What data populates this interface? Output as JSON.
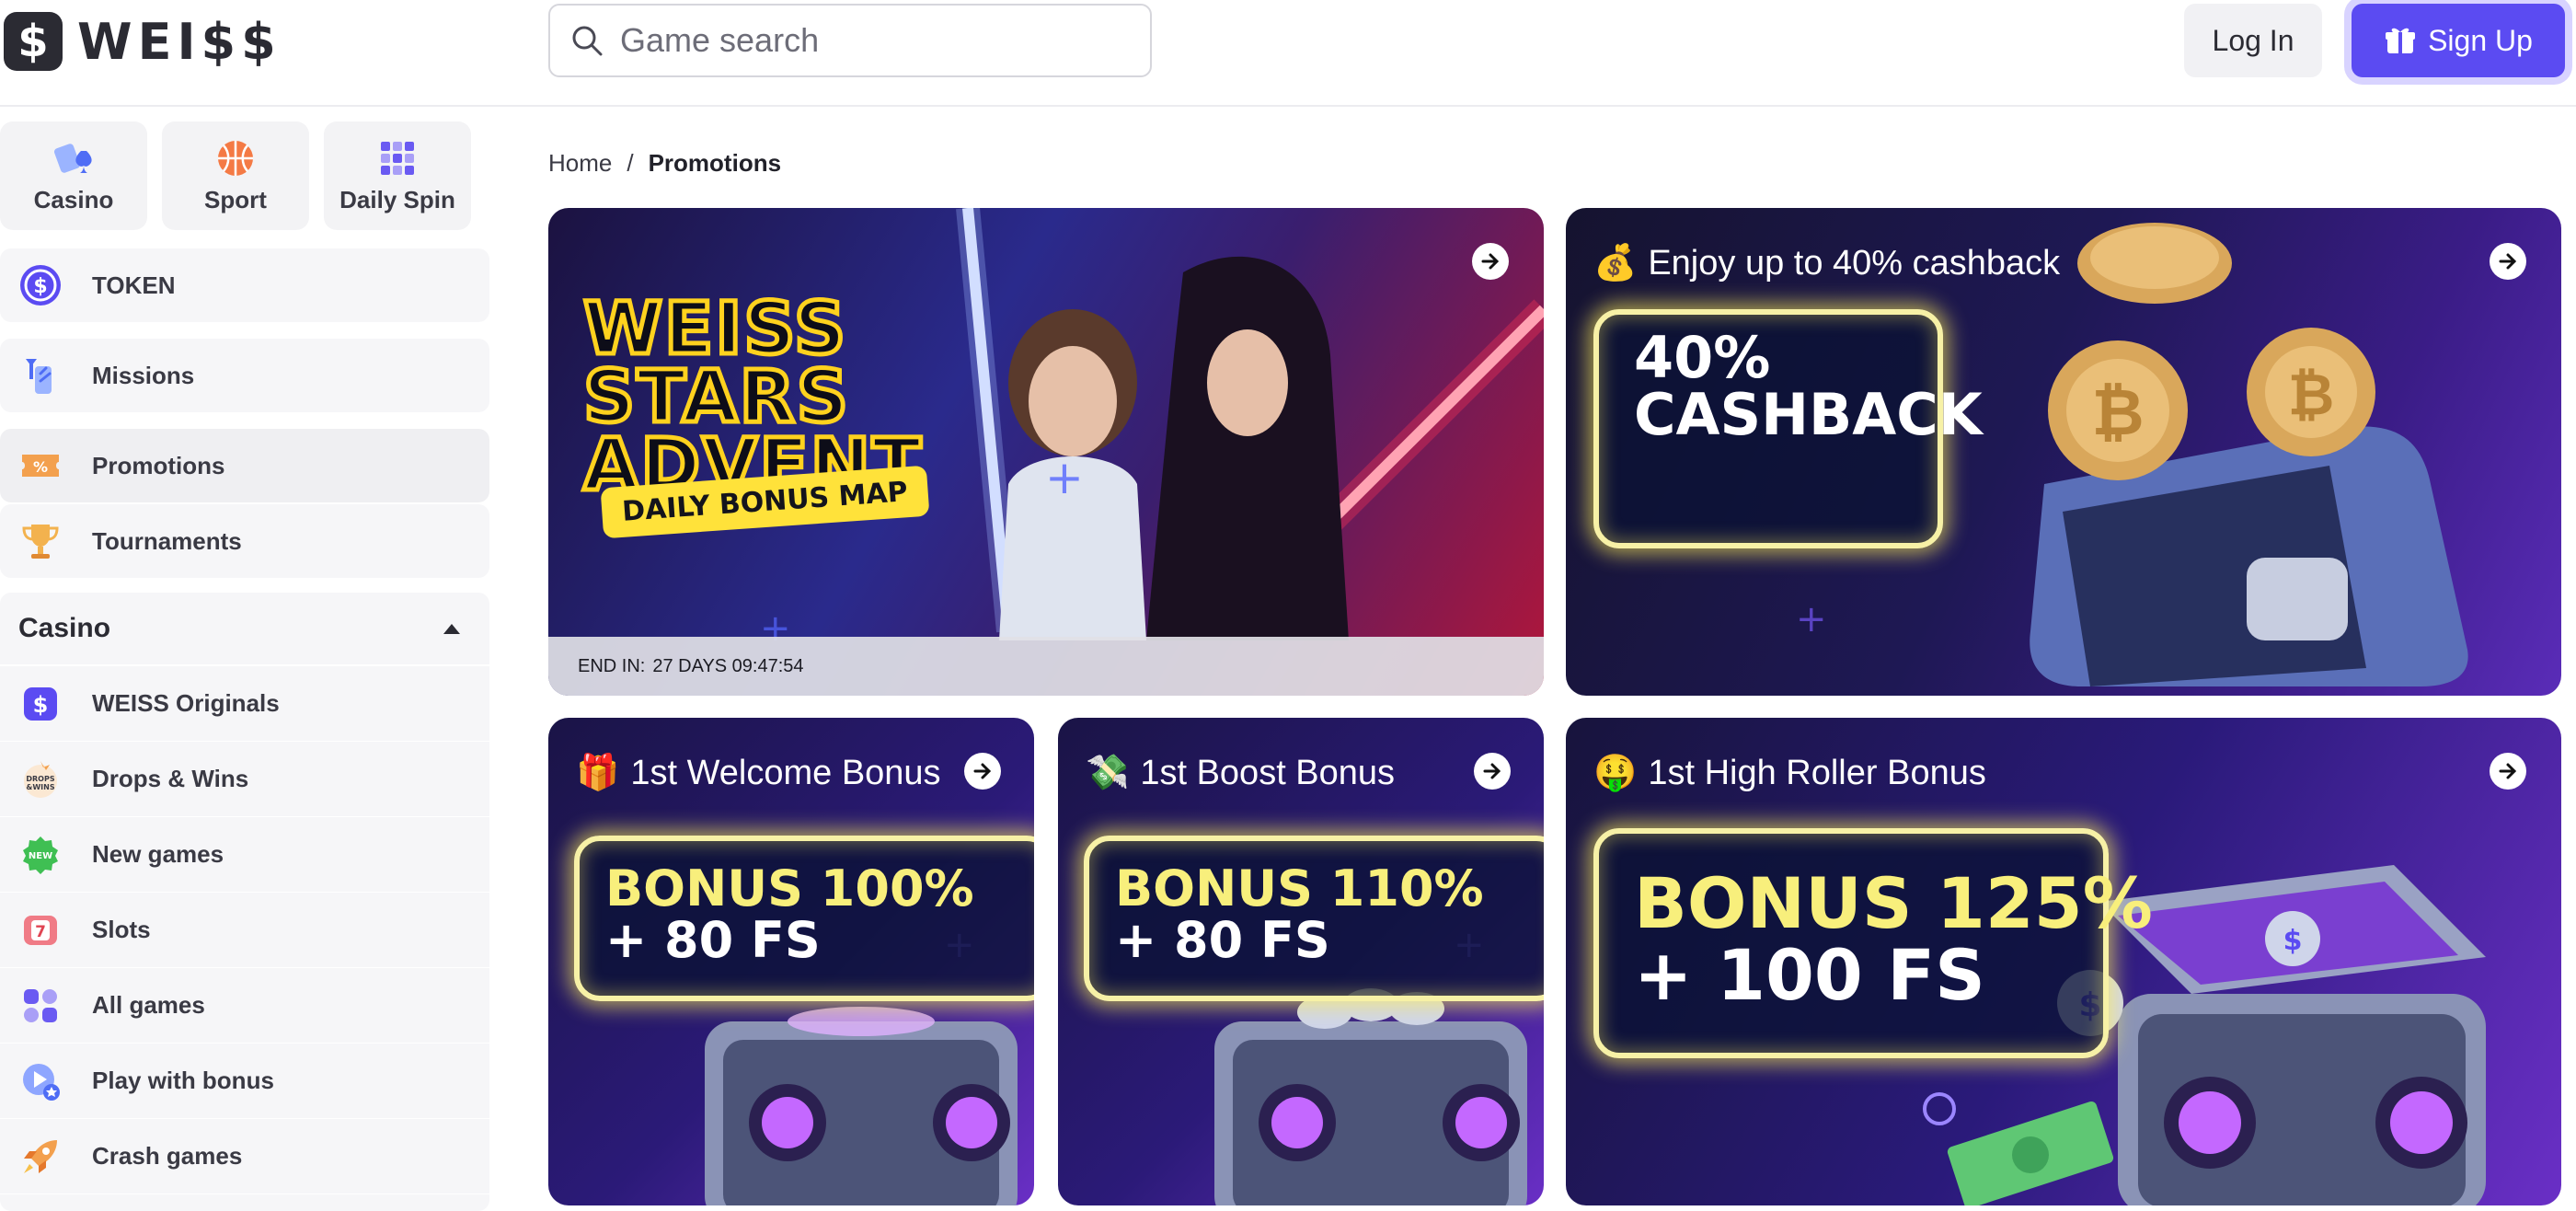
{
  "brand": {
    "logo_letter": "$",
    "name": "WEI$$"
  },
  "search": {
    "placeholder": "Game search"
  },
  "header": {
    "login_label": "Log In",
    "signup_label": "Sign Up"
  },
  "sidebar": {
    "top_categories": [
      {
        "label": "Casino",
        "icon": "cards-icon"
      },
      {
        "label": "Sport",
        "icon": "basketball-icon"
      },
      {
        "label": "Daily Spin",
        "icon": "grid-icon"
      }
    ],
    "items": [
      {
        "label": "TOKEN",
        "icon": "token-icon"
      },
      {
        "label": "Missions",
        "icon": "missions-icon"
      },
      {
        "label": "Promotions",
        "icon": "ticket-icon"
      },
      {
        "label": "Tournaments",
        "icon": "trophy-icon"
      }
    ],
    "casino_group": {
      "title": "Casino",
      "items": [
        {
          "label": "WEISS Originals",
          "icon": "originals-icon"
        },
        {
          "label": "Drops & Wins",
          "icon": "drops-icon",
          "icon_text": "DROPS &WINS"
        },
        {
          "label": "New games",
          "icon": "new-badge-icon",
          "icon_text": "NEW"
        },
        {
          "label": "Slots",
          "icon": "slot-icon",
          "icon_text": "7"
        },
        {
          "label": "All games",
          "icon": "all-games-icon"
        },
        {
          "label": "Play with bonus",
          "icon": "play-bonus-icon"
        },
        {
          "label": "Crash games",
          "icon": "rocket-icon"
        }
      ]
    }
  },
  "breadcrumb": {
    "home": "Home",
    "separator": "/",
    "current": "Promotions"
  },
  "promos": {
    "advent": {
      "line1": "WEISS",
      "line2": "STARS",
      "line3": "ADVENT",
      "tag": "DAILY BONUS MAP",
      "timer_label": "END IN:",
      "timer_value": "27 DAYS 09:47:54"
    },
    "cashback": {
      "emoji": "💰",
      "title": "Enjoy up to 40% cashback",
      "big1": "40%",
      "big2": "CASHBACK"
    },
    "welcome": {
      "emoji": "🎁",
      "title": "1st Welcome Bonus",
      "big1": "BONUS 100%",
      "big2": "+ 80 FS"
    },
    "boost": {
      "emoji": "💸",
      "title": "1st Boost Bonus",
      "big1": "BONUS 110%",
      "big2": "+ 80 FS"
    },
    "highroller": {
      "emoji": "🤑",
      "title": "1st High Roller Bonus",
      "big1": "BONUS 125%",
      "big2": "+ 100 FS"
    }
  },
  "colors": {
    "accent": "#5b4bf2",
    "neon_yellow": "#f7f1a6",
    "promo_bg": "#2a1470"
  }
}
